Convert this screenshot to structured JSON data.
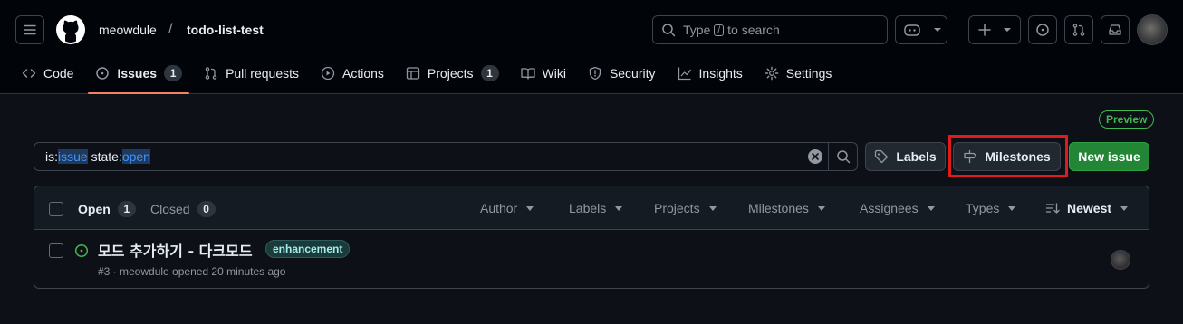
{
  "header": {
    "owner": "meowdule",
    "separator": "/",
    "repo": "todo-list-test",
    "search": {
      "pre": "Type",
      "key": "/",
      "post": "to search"
    }
  },
  "nav": {
    "code": "Code",
    "issues": "Issues",
    "issues_count": "1",
    "pulls": "Pull requests",
    "actions": "Actions",
    "projects": "Projects",
    "projects_count": "1",
    "wiki": "Wiki",
    "security": "Security",
    "insights": "Insights",
    "settings": "Settings"
  },
  "toolbar": {
    "preview_badge": "Preview",
    "query": {
      "k1": "is:",
      "v1": "issue",
      "k2": " state:",
      "v2": "open"
    },
    "labels_button": "Labels",
    "milestones_button": "Milestones",
    "new_issue_button": "New issue"
  },
  "list": {
    "open_label": "Open",
    "open_count": "1",
    "closed_label": "Closed",
    "closed_count": "0",
    "filters": {
      "author": "Author",
      "labels": "Labels",
      "projects": "Projects",
      "milestones": "Milestones",
      "assignees": "Assignees",
      "types": "Types",
      "sort": "Newest"
    },
    "issues": [
      {
        "title": "모드 추가하기 - 다크모드",
        "label": "enhancement",
        "meta": "#3 · meowdule opened 20 minutes ago"
      }
    ]
  },
  "colors": {
    "accent_underline": "#f78166",
    "primary_button": "#238636",
    "highlight_box": "#e01b1b",
    "open_icon": "#3fb950"
  }
}
